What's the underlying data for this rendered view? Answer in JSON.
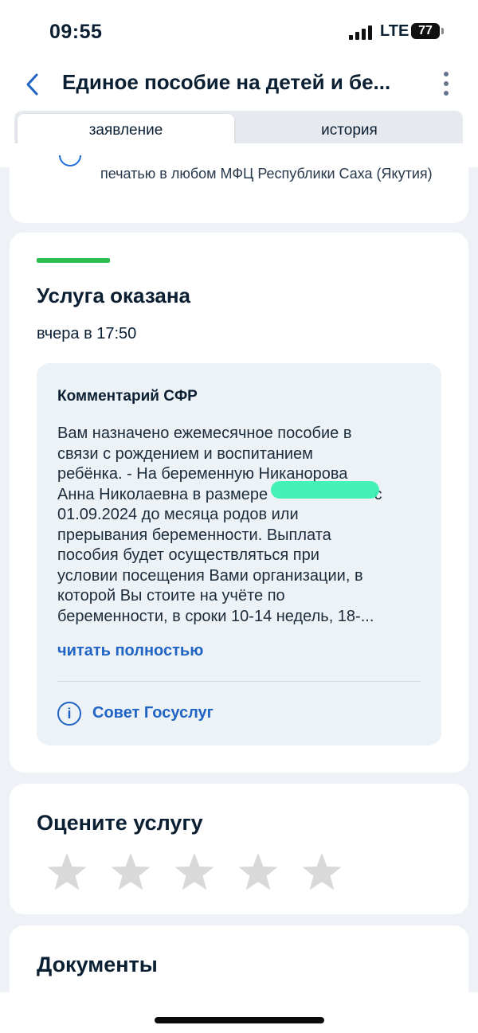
{
  "status_bar": {
    "time": "09:55",
    "network": "LTE",
    "battery": "77"
  },
  "header": {
    "title": "Единое пособие на детей и бе...",
    "back_icon": "chevron-left-icon",
    "menu_icon": "kebab-menu-icon"
  },
  "tabs": [
    {
      "label": "заявление",
      "active": true
    },
    {
      "label": "история",
      "active": false
    }
  ],
  "previous_card": {
    "text": "печатью в любом МФЦ Республики Саха (Якутия)"
  },
  "status_card": {
    "accent_color": "#2cbf4f",
    "title": "Услуга оказана",
    "time": "вчера в 17:50",
    "comment": {
      "title": "Комментарий СФР",
      "lines": [
        "Вам назначено ежемесячное пособие в",
        "связи с рождением и воспитанием",
        "ребёнка. - На беременную Никанорова",
        "Анна Николаевна в размере                        с",
        "01.09.2024 до месяца родов или",
        "прерывания беременности. Выплата",
        "пособия будет осуществляться при",
        "условии посещения Вами организации, в",
        "которой Вы стоите на учёте по",
        "беременности, в сроки 10-14 недель, 18-..."
      ],
      "read_more": "читать полностью",
      "advice_label": "Совет Госуслуг",
      "advice_icon": "info-icon"
    }
  },
  "rating": {
    "title": "Оцените услугу",
    "max_stars": 5,
    "selected": 0,
    "star_color": "#d9d9d9"
  },
  "documents": {
    "title": "Документы"
  },
  "colors": {
    "link": "#1f64c4",
    "background": "#eef1f5",
    "card": "#ffffff"
  }
}
